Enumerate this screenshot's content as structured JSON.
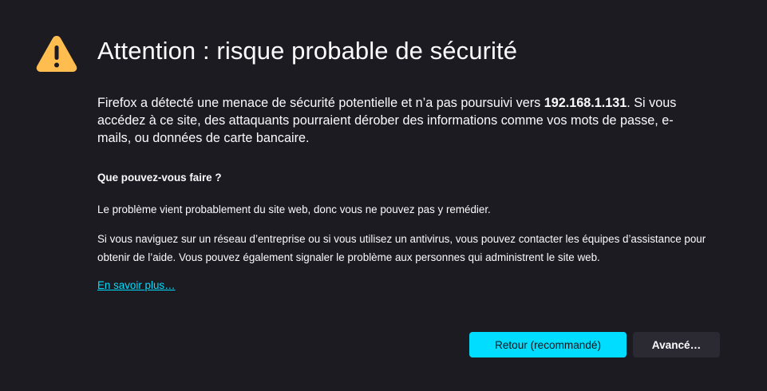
{
  "page": {
    "title": "Attention : risque probable de sécurité",
    "intro_before": "Firefox a détecté une menace de sécurité potentielle et n’a pas poursuivi vers ",
    "host": "192.168.1.131",
    "intro_after": ". Si vous accédez à ce site, des attaquants pourraient dérober des informations comme vos mots de passe, e-mails, ou données de carte bancaire.",
    "subheading": "Que pouvez-vous faire ?",
    "paragraph1": "Le problème vient probablement du site web, donc vous ne pouvez pas y remédier.",
    "paragraph2": "Si vous naviguez sur un réseau d’entreprise ou si vous utilisez un antivirus, vous pouvez contacter les équipes d’assistance pour obtenir de l’aide. Vous pouvez également signaler le problème aux personnes qui administrent le site web.",
    "learn_more": "En savoir plus…"
  },
  "buttons": {
    "back": "Retour (recommandé)",
    "advanced": "Avancé…"
  },
  "icons": {
    "warning": "warning-triangle-icon"
  },
  "colors": {
    "background": "#1c1b22",
    "text": "#fbfbfe",
    "accent": "#00ddff",
    "warning": "#ffbd4f",
    "secondary_button": "#2b2a33"
  }
}
